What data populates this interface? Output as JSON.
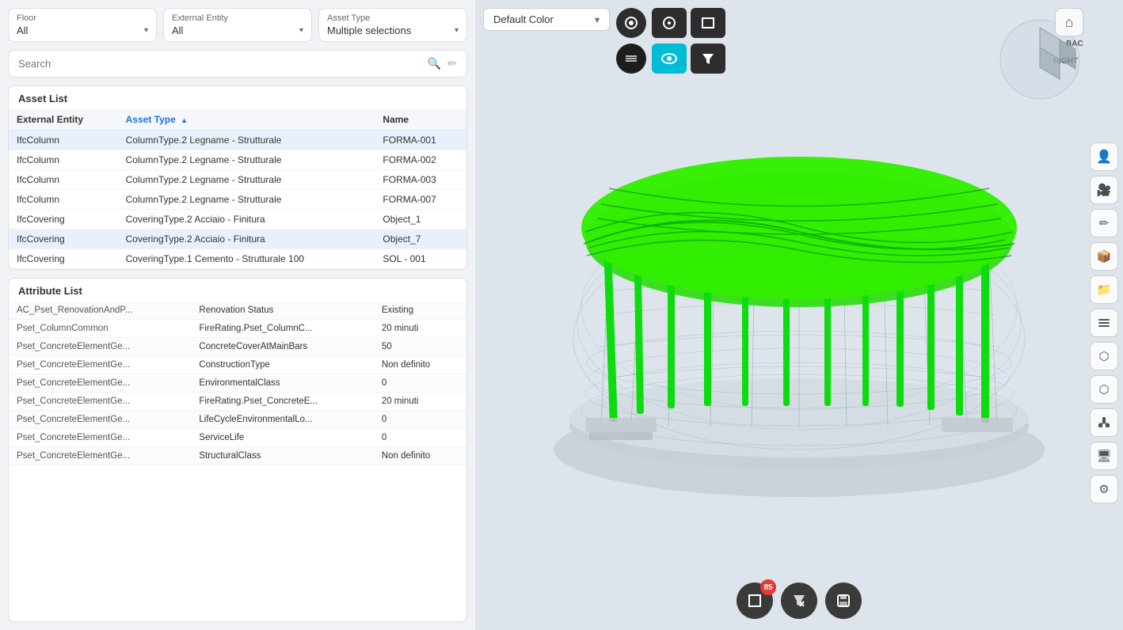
{
  "filters": {
    "floor": {
      "label": "Floor",
      "value": "All"
    },
    "external_entity": {
      "label": "External Entity",
      "value": "All"
    },
    "asset_type": {
      "label": "Asset Type",
      "value": "Multiple selections"
    }
  },
  "search": {
    "placeholder": "Search"
  },
  "asset_list": {
    "title": "Asset List",
    "columns": [
      {
        "key": "external_entity",
        "label": "External Entity",
        "sorted": false
      },
      {
        "key": "asset_type",
        "label": "Asset Type",
        "sorted": true,
        "sort_dir": "asc"
      },
      {
        "key": "name",
        "label": "Name",
        "sorted": false
      }
    ],
    "rows": [
      {
        "external_entity": "IfcColumn",
        "asset_type": "ColumnType.2 Legname - Strutturale",
        "name": "FORMA-001",
        "selected": true
      },
      {
        "external_entity": "IfcColumn",
        "asset_type": "ColumnType.2 Legname - Strutturale",
        "name": "FORMA-002",
        "selected": false
      },
      {
        "external_entity": "IfcColumn",
        "asset_type": "ColumnType.2 Legname - Strutturale",
        "name": "FORMA-003",
        "selected": false
      },
      {
        "external_entity": "IfcColumn",
        "asset_type": "ColumnType.2 Legname - Strutturale",
        "name": "FORMA-007",
        "selected": false
      },
      {
        "external_entity": "IfcCovering",
        "asset_type": "CoveringType.2 Acciaio - Finitura",
        "name": "Object_1",
        "selected": false
      },
      {
        "external_entity": "IfcCovering",
        "asset_type": "CoveringType.2 Acciaio - Finitura",
        "name": "Object_7",
        "selected": true
      },
      {
        "external_entity": "IfcCovering",
        "asset_type": "CoveringType.1 Cemento - Strutturale 100",
        "name": "SOL - 001",
        "selected": false
      }
    ]
  },
  "attribute_list": {
    "title": "Attribute List",
    "rows": [
      {
        "pset": "AC_Pset_RenovationAndP...",
        "attribute": "Renovation Status",
        "value": "Existing"
      },
      {
        "pset": "Pset_ColumnCommon",
        "attribute": "FireRating.Pset_ColumnC...",
        "value": "20 minuti"
      },
      {
        "pset": "Pset_ConcreteElementGe...",
        "attribute": "ConcreteCoverAtMainBars",
        "value": "50"
      },
      {
        "pset": "Pset_ConcreteElementGe...",
        "attribute": "ConstructionType",
        "value": "Non definito"
      },
      {
        "pset": "Pset_ConcreteElementGe...",
        "attribute": "EnvironmentalClass",
        "value": "0"
      },
      {
        "pset": "Pset_ConcreteElementGe...",
        "attribute": "FireRating.Pset_ConcreteE...",
        "value": "20 minuti"
      },
      {
        "pset": "Pset_ConcreteElementGe...",
        "attribute": "LifeCycleEnvironmentalLo...",
        "value": "0"
      },
      {
        "pset": "Pset_ConcreteElementGe...",
        "attribute": "ServiceLife",
        "value": "0"
      },
      {
        "pset": "Pset_ConcreteElementGe...",
        "attribute": "StructuralClass",
        "value": "Non definito"
      }
    ]
  },
  "viewport": {
    "color_dropdown": {
      "label": "Default Color"
    },
    "toolbar": {
      "buttons": [
        {
          "id": "layers",
          "icon": "⊞",
          "active": false
        },
        {
          "id": "target",
          "icon": "◎",
          "active": false
        },
        {
          "id": "rect-select",
          "icon": "▣",
          "active": false,
          "rect": true
        },
        {
          "id": "hatch",
          "icon": "▦",
          "active": false,
          "rect": true
        },
        {
          "id": "stack",
          "icon": "≡",
          "active": false
        },
        {
          "id": "eye",
          "icon": "◉",
          "active": true,
          "rect": true
        },
        {
          "id": "filter",
          "icon": "⊲",
          "active": false,
          "rect": true
        }
      ]
    },
    "right_toolbar": [
      {
        "id": "home",
        "icon": "⌂"
      },
      {
        "id": "cube-view",
        "icon": "⬜"
      }
    ],
    "right_side_tools": [
      {
        "id": "person",
        "icon": "👤"
      },
      {
        "id": "camera",
        "icon": "📷"
      },
      {
        "id": "pencil",
        "icon": "✏"
      },
      {
        "id": "box",
        "icon": "📦"
      },
      {
        "id": "folder",
        "icon": "📁"
      },
      {
        "id": "layers2",
        "icon": "◫"
      },
      {
        "id": "cube2",
        "icon": "⬡"
      },
      {
        "id": "nodes",
        "icon": "⬡"
      },
      {
        "id": "tree",
        "icon": "⎇"
      },
      {
        "id": "monitor",
        "icon": "🖥"
      },
      {
        "id": "settings",
        "icon": "⚙"
      }
    ],
    "bottom_toolbar": [
      {
        "id": "select",
        "icon": "☐",
        "badge": "85"
      },
      {
        "id": "filter-clear",
        "icon": "✕",
        "badge": null
      },
      {
        "id": "save",
        "icon": "💾",
        "badge": null
      }
    ]
  }
}
